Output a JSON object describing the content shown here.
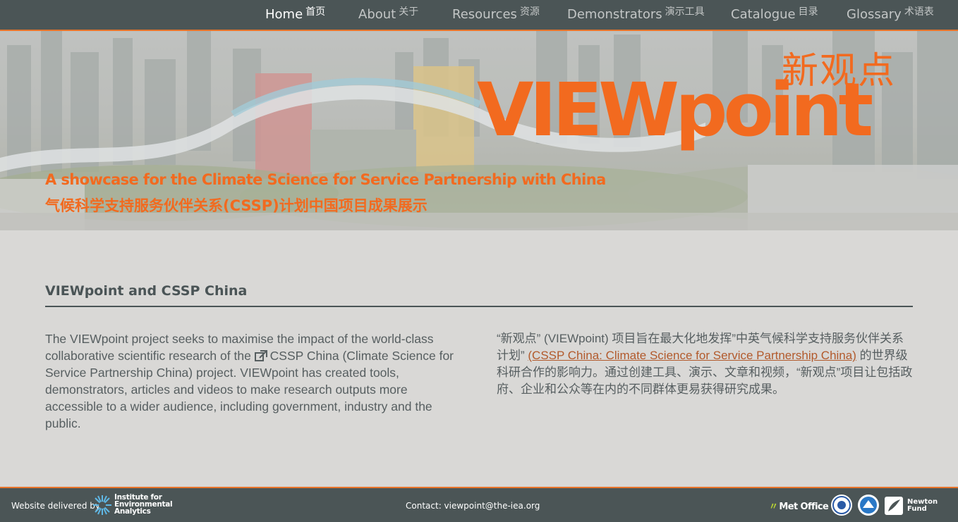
{
  "nav": {
    "items": [
      {
        "label": "Home",
        "label_zh": "首页",
        "active": true
      },
      {
        "label": "About",
        "label_zh": "关于"
      },
      {
        "label": "Resources",
        "label_zh": "资源"
      },
      {
        "label": "Demonstrators",
        "label_zh": "演示工具"
      },
      {
        "label": "Catalogue",
        "label_zh": "目录"
      },
      {
        "label": "Glossary",
        "label_zh": "术语表"
      }
    ]
  },
  "hero": {
    "logo_zh": "新观点",
    "logo_en": "VIEWpoint",
    "tagline_en": "A showcase for the Climate Science for Service Partnership with China",
    "tagline_zh": "气候科学支持服务伙伴关系(CSSP)计划中国项目成果展示"
  },
  "main": {
    "section_title": "VIEWpoint and CSSP China",
    "para_en_before": "The VIEWpoint project seeks to maximise the impact of the world-class collaborative scientific research of the ",
    "para_en_after": "CSSP China (Climate Science for Service Partnership China) project. VIEWpoint has created tools, demonstrators, articles and videos to make research outputs more accessible to a wider audience, including government, industry and the public.",
    "para_zh_before": "“新观点” (VIEWpoint) 项目旨在最大化地发挥”中英气候科学支持服务伙伴关系计划” ",
    "para_zh_link": "(CSSP China: Climate Science for Service Partnership China)",
    "para_zh_after": " 的世界级科研合作的影响力。通过创建工具、演示、文章和视频，“新观点”项目让包括政府、企业和公众等在内的不同群体更易获得研究成果。"
  },
  "footer": {
    "delivered_by": "Website delivered by",
    "iea_name": [
      "Institute for",
      "Environmental",
      "Analytics"
    ],
    "contact": "Contact: viewpoint@the-iea.org",
    "met_office": "Met Office",
    "newton_fund": [
      "Newton",
      "Fund"
    ]
  },
  "colors": {
    "brand_orange": "#f26a1f",
    "nav_bg": "#4b5556",
    "page_bg": "#d9d8d6",
    "link": "#b25a2c"
  }
}
